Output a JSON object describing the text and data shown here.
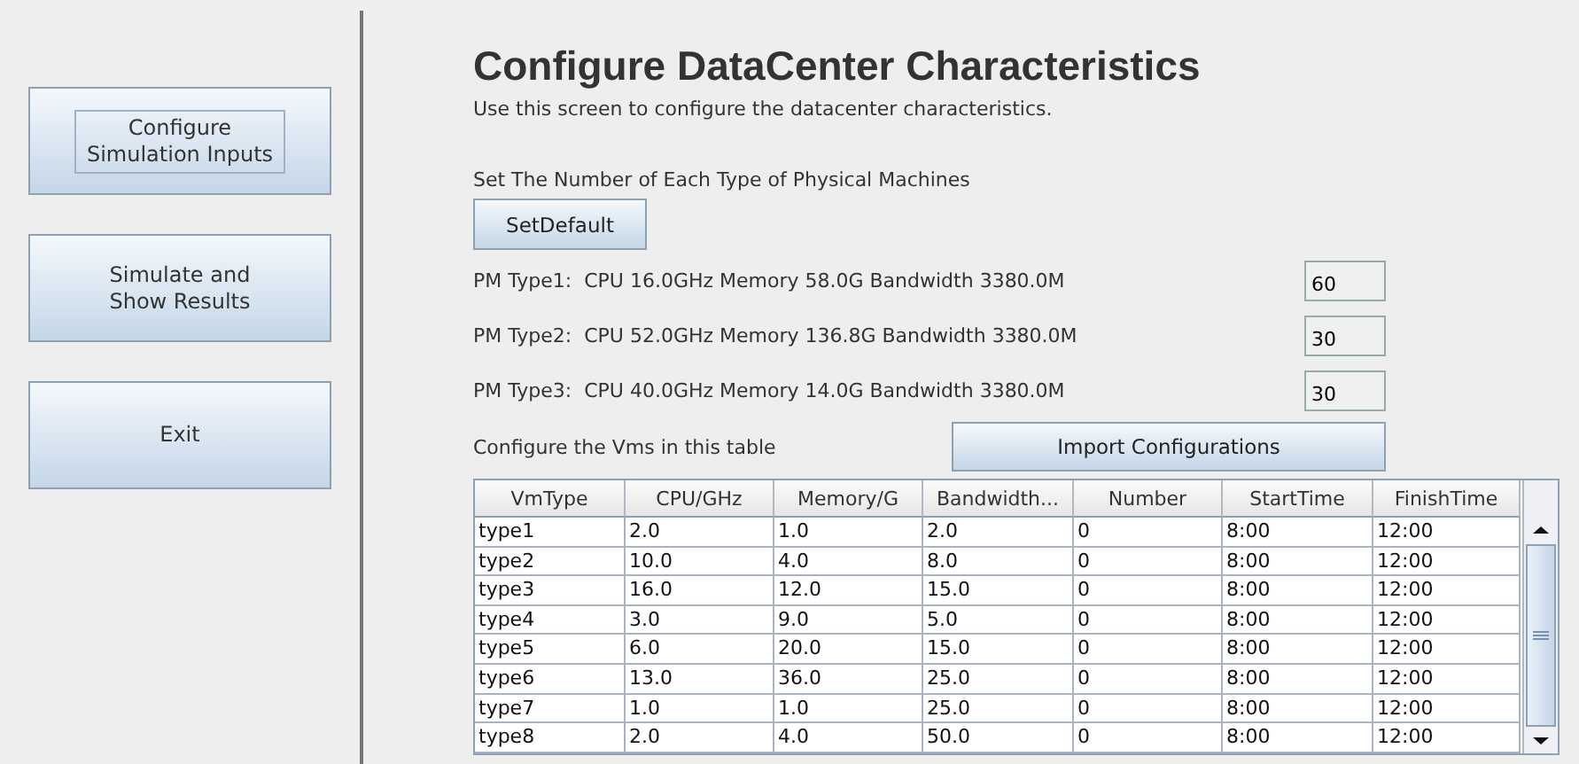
{
  "sidebar": {
    "buttons": [
      {
        "label": "Configure\nSimulation Inputs",
        "focused": true
      },
      {
        "label": "Simulate and\nShow Results",
        "focused": false
      },
      {
        "label": "Exit",
        "focused": false
      }
    ]
  },
  "title": "Configure DataCenter Characteristics",
  "subtitle": "Use this screen to configure the datacenter characteristics.",
  "pm_section": {
    "label": "Set The Number of Each Type of Physical Machines",
    "button": "SetDefault",
    "machines": [
      {
        "name": "PM Type1:",
        "spec": "CPU 16.0GHz Memory 58.0G Bandwidth 3380.0M",
        "count": "60"
      },
      {
        "name": "PM Type2:",
        "spec": "CPU 52.0GHz Memory 136.8G Bandwidth 3380.0M",
        "count": "30"
      },
      {
        "name": "PM Type3:",
        "spec": "CPU 40.0GHz Memory 14.0G Bandwidth 3380.0M",
        "count": "30"
      }
    ]
  },
  "vm_section": {
    "label": "Configure the Vms in this table",
    "button": "Import Configurations"
  },
  "table": {
    "columns": [
      "VmType",
      "CPU/GHz",
      "Memory/G",
      "Bandwidth...",
      "Number",
      "StartTime",
      "FinishTime"
    ],
    "rows": [
      [
        "type1",
        "2.0",
        "1.0",
        "2.0",
        "0",
        "8:00",
        "12:00"
      ],
      [
        "type2",
        "10.0",
        "4.0",
        "8.0",
        "0",
        "8:00",
        "12:00"
      ],
      [
        "type3",
        "16.0",
        "12.0",
        "15.0",
        "0",
        "8:00",
        "12:00"
      ],
      [
        "type4",
        "3.0",
        "9.0",
        "5.0",
        "0",
        "8:00",
        "12:00"
      ],
      [
        "type5",
        "6.0",
        "20.0",
        "15.0",
        "0",
        "8:00",
        "12:00"
      ],
      [
        "type6",
        "13.0",
        "36.0",
        "25.0",
        "0",
        "8:00",
        "12:00"
      ],
      [
        "type7",
        "1.0",
        "1.0",
        "25.0",
        "0",
        "8:00",
        "12:00"
      ],
      [
        "type8",
        "2.0",
        "4.0",
        "50.0",
        "0",
        "8:00",
        "12:00"
      ]
    ]
  }
}
